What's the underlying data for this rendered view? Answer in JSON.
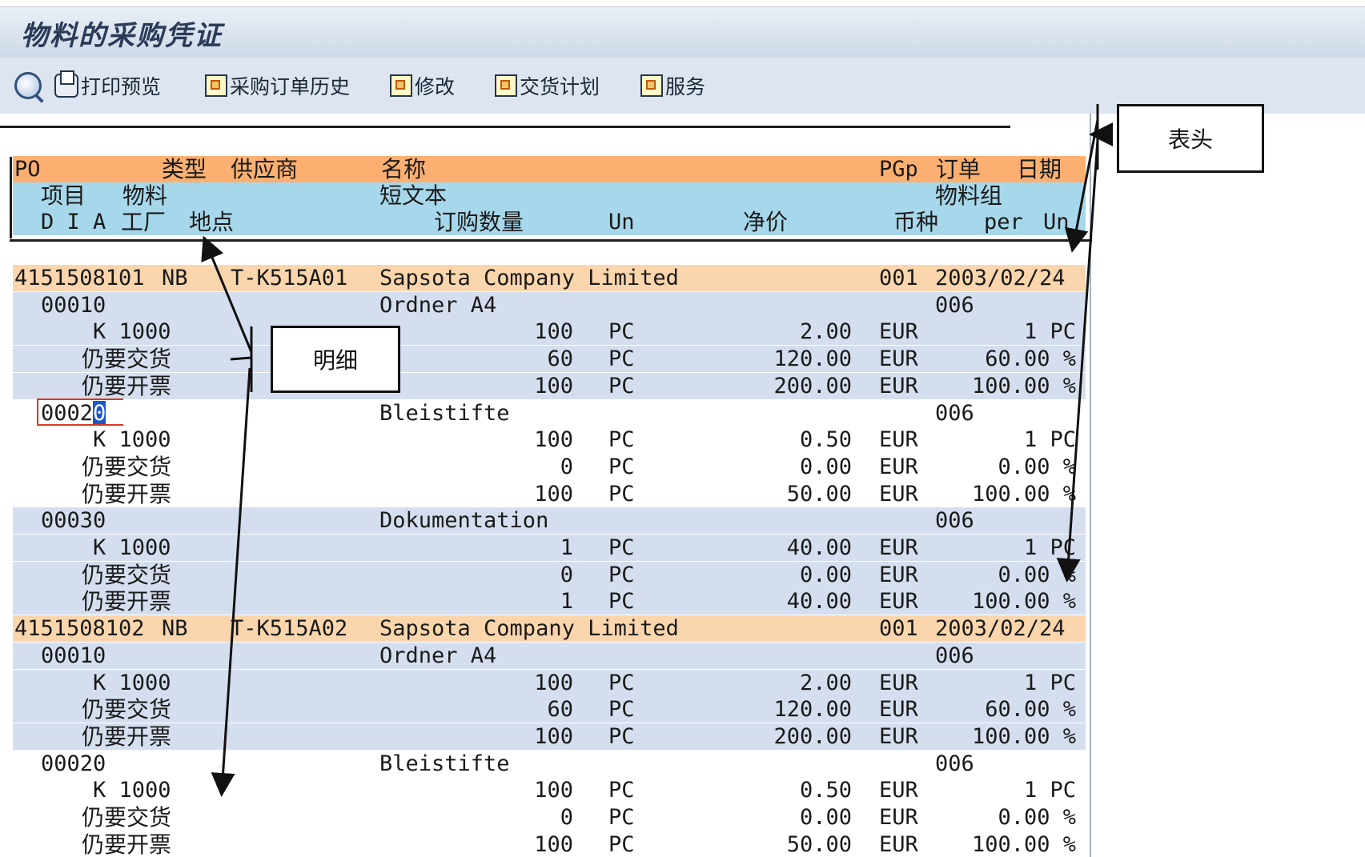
{
  "window": {
    "title": "物料的采购凭证"
  },
  "toolbar": {
    "print_preview": "打印预览",
    "po_history": "采购订单历史",
    "change": "修改",
    "delivery_schedule": "交货计划",
    "services": "服务"
  },
  "columns": {
    "header_row": {
      "po": "PO",
      "type": "类型",
      "vendor": "供应商",
      "name": "名称",
      "pgp": "PGp",
      "order": "订单",
      "date": "日期"
    },
    "item_row": {
      "item": "项目",
      "material": "物料",
      "short_text": "短文本",
      "material_group": "物料组"
    },
    "detail_row": {
      "dia": "D I A",
      "plant": "工厂",
      "location": "地点",
      "quantity": "订购数量",
      "unit": "Un",
      "net_price": "净价",
      "currency": "币种",
      "per": "per",
      "per_unit": "Un"
    }
  },
  "rows": [
    {
      "kind": "po",
      "po": "4151508101",
      "type": "NB",
      "vendor": "T-K515A01",
      "name": "Sapsota Company Limited",
      "pgp": "001",
      "date": "2003/02/24"
    },
    {
      "kind": "item",
      "bg": "blue",
      "item": "00010",
      "text": "Ordner A4",
      "group": "006"
    },
    {
      "kind": "detail",
      "bg": "blue",
      "label": "K 1000",
      "qty": "100",
      "un": "PC",
      "price": "2.00",
      "cur": "EUR",
      "per": "1 PC"
    },
    {
      "kind": "detail",
      "bg": "blue",
      "label": "仍要交货",
      "zh": true,
      "qty": "60",
      "un": "PC",
      "price": "120.00",
      "cur": "EUR",
      "per": "60.00 %"
    },
    {
      "kind": "detail",
      "bg": "blue",
      "label": "仍要开票",
      "zh": true,
      "qty": "100",
      "un": "PC",
      "price": "200.00",
      "cur": "EUR",
      "per": "100.00 %"
    },
    {
      "kind": "item",
      "bg": "white",
      "item_a": "0002",
      "item_b": "0",
      "text": "Bleistifte",
      "group": "006",
      "cursor": true
    },
    {
      "kind": "detail",
      "bg": "white",
      "label": "K 1000",
      "qty": "100",
      "un": "PC",
      "price": "0.50",
      "cur": "EUR",
      "per": "1 PC"
    },
    {
      "kind": "detail",
      "bg": "white",
      "label": "仍要交货",
      "zh": true,
      "qty": "0",
      "un": "PC",
      "price": "0.00",
      "cur": "EUR",
      "per": "0.00 %"
    },
    {
      "kind": "detail",
      "bg": "white",
      "label": "仍要开票",
      "zh": true,
      "qty": "100",
      "un": "PC",
      "price": "50.00",
      "cur": "EUR",
      "per": "100.00 %"
    },
    {
      "kind": "item",
      "bg": "blue",
      "item": "00030",
      "text": "Dokumentation",
      "group": "006"
    },
    {
      "kind": "detail",
      "bg": "blue",
      "label": "K 1000",
      "qty": "1",
      "un": "PC",
      "price": "40.00",
      "cur": "EUR",
      "per": "1 PC"
    },
    {
      "kind": "detail",
      "bg": "blue",
      "label": "仍要交货",
      "zh": true,
      "qty": "0",
      "un": "PC",
      "price": "0.00",
      "cur": "EUR",
      "per": "0.00 %"
    },
    {
      "kind": "detail",
      "bg": "blue",
      "label": "仍要开票",
      "zh": true,
      "qty": "1",
      "un": "PC",
      "price": "40.00",
      "cur": "EUR",
      "per": "100.00 %"
    },
    {
      "kind": "po",
      "po": "4151508102",
      "type": "NB",
      "vendor": "T-K515A02",
      "name": "Sapsota Company Limited",
      "pgp": "001",
      "date": "2003/02/24"
    },
    {
      "kind": "item",
      "bg": "blue",
      "item": "00010",
      "text": "Ordner A4",
      "group": "006"
    },
    {
      "kind": "detail",
      "bg": "blue",
      "label": "K 1000",
      "qty": "100",
      "un": "PC",
      "price": "2.00",
      "cur": "EUR",
      "per": "1 PC"
    },
    {
      "kind": "detail",
      "bg": "blue",
      "label": "仍要交货",
      "zh": true,
      "qty": "60",
      "un": "PC",
      "price": "120.00",
      "cur": "EUR",
      "per": "60.00 %"
    },
    {
      "kind": "detail",
      "bg": "blue",
      "label": "仍要开票",
      "zh": true,
      "qty": "100",
      "un": "PC",
      "price": "200.00",
      "cur": "EUR",
      "per": "100.00 %"
    },
    {
      "kind": "item",
      "bg": "white",
      "item": "00020",
      "text": "Bleistifte",
      "group": "006"
    },
    {
      "kind": "detail",
      "bg": "white",
      "label": "K 1000",
      "qty": "100",
      "un": "PC",
      "price": "0.50",
      "cur": "EUR",
      "per": "1 PC"
    },
    {
      "kind": "detail",
      "bg": "white",
      "label": "仍要交货",
      "zh": true,
      "qty": "0",
      "un": "PC",
      "price": "0.00",
      "cur": "EUR",
      "per": "0.00 %"
    },
    {
      "kind": "detail",
      "bg": "white",
      "label": "仍要开票",
      "zh": true,
      "qty": "100",
      "un": "PC",
      "price": "50.00",
      "cur": "EUR",
      "per": "100.00 %"
    }
  ],
  "callouts": {
    "header": "表头",
    "detail": "明细"
  }
}
